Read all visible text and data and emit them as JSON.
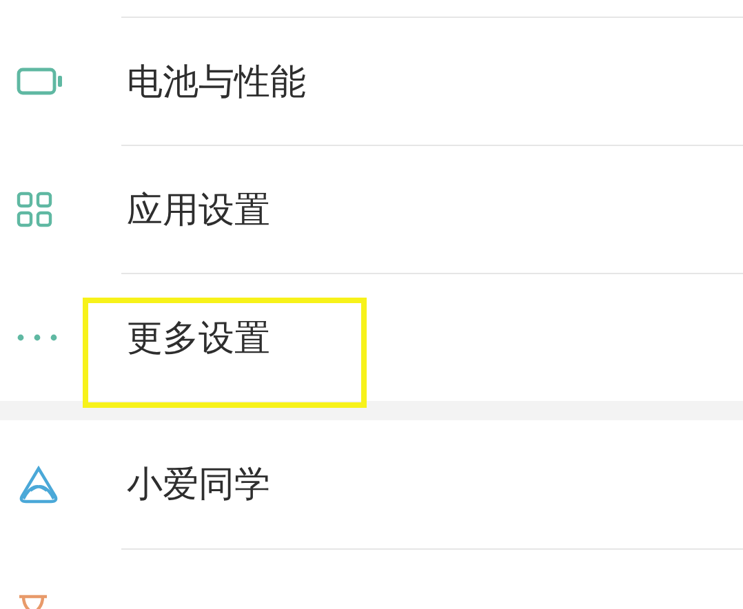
{
  "groups": [
    {
      "items": [
        {
          "kind": "battery",
          "label": "电池与性能",
          "highlighted": false
        },
        {
          "kind": "apps",
          "label": "应用设置",
          "highlighted": false
        },
        {
          "kind": "more",
          "label": "更多设置",
          "highlighted": true
        }
      ]
    },
    {
      "items": [
        {
          "kind": "assistant",
          "label": "小爱同学",
          "highlighted": false
        },
        {
          "kind": "timer"
        }
      ]
    }
  ]
}
